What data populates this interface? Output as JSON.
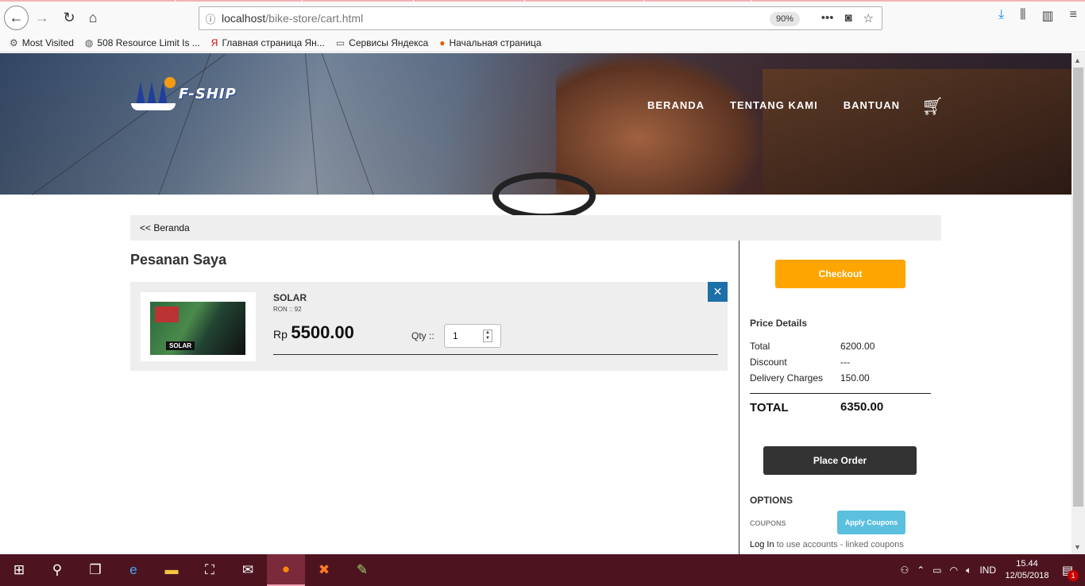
{
  "browser": {
    "url_host": "localhost",
    "url_path": "/bike-store/cart.html",
    "zoom": "90%",
    "bookmarks": [
      {
        "label": "Most Visited",
        "icon": "gear-icon"
      },
      {
        "label": "508 Resource Limit Is ...",
        "icon": "globe-icon"
      },
      {
        "label": "Главная страница Ян...",
        "icon": "yandex-icon"
      },
      {
        "label": "Сервисы Яндекса",
        "icon": "folder-icon"
      },
      {
        "label": "Начальная страница",
        "icon": "firefox-icon"
      }
    ]
  },
  "site": {
    "logo_text": "F-SHIP",
    "menu": [
      "BERANDA",
      "TENTANG KAMI",
      "BANTUAN"
    ],
    "breadcrumb": "<< Beranda",
    "heading": "Pesanan Saya"
  },
  "cart_item": {
    "name": "SOLAR",
    "sub": "RON :: 92",
    "image_label": "SOLAR",
    "currency": "Rp",
    "price": "5500.00",
    "qty_label": "Qty ::",
    "qty_value": "1",
    "remove": "✕"
  },
  "summary": {
    "checkout": "Checkout",
    "price_details": "Price Details",
    "rows": [
      {
        "label": "Total",
        "value": "6200.00"
      },
      {
        "label": "Discount",
        "value": "---"
      },
      {
        "label": "Delivery Charges",
        "value": "150.00"
      }
    ],
    "total_label": "TOTAL",
    "total_value": "6350.00",
    "place_order": "Place Order",
    "options": "OPTIONS",
    "coupons": "COUPONS",
    "apply_coupons": "Apply Coupons",
    "login_link": "Log In",
    "login_text": " to use accounts - linked coupons"
  },
  "taskbar": {
    "lang": "IND",
    "time": "15.44",
    "date": "12/05/2018",
    "notifications": "1"
  },
  "colors": {
    "checkout": "#ffa500",
    "place_order": "#333333",
    "apply": "#5bc0de",
    "remove": "#1c6fa8",
    "taskbar": "#4d1420"
  }
}
